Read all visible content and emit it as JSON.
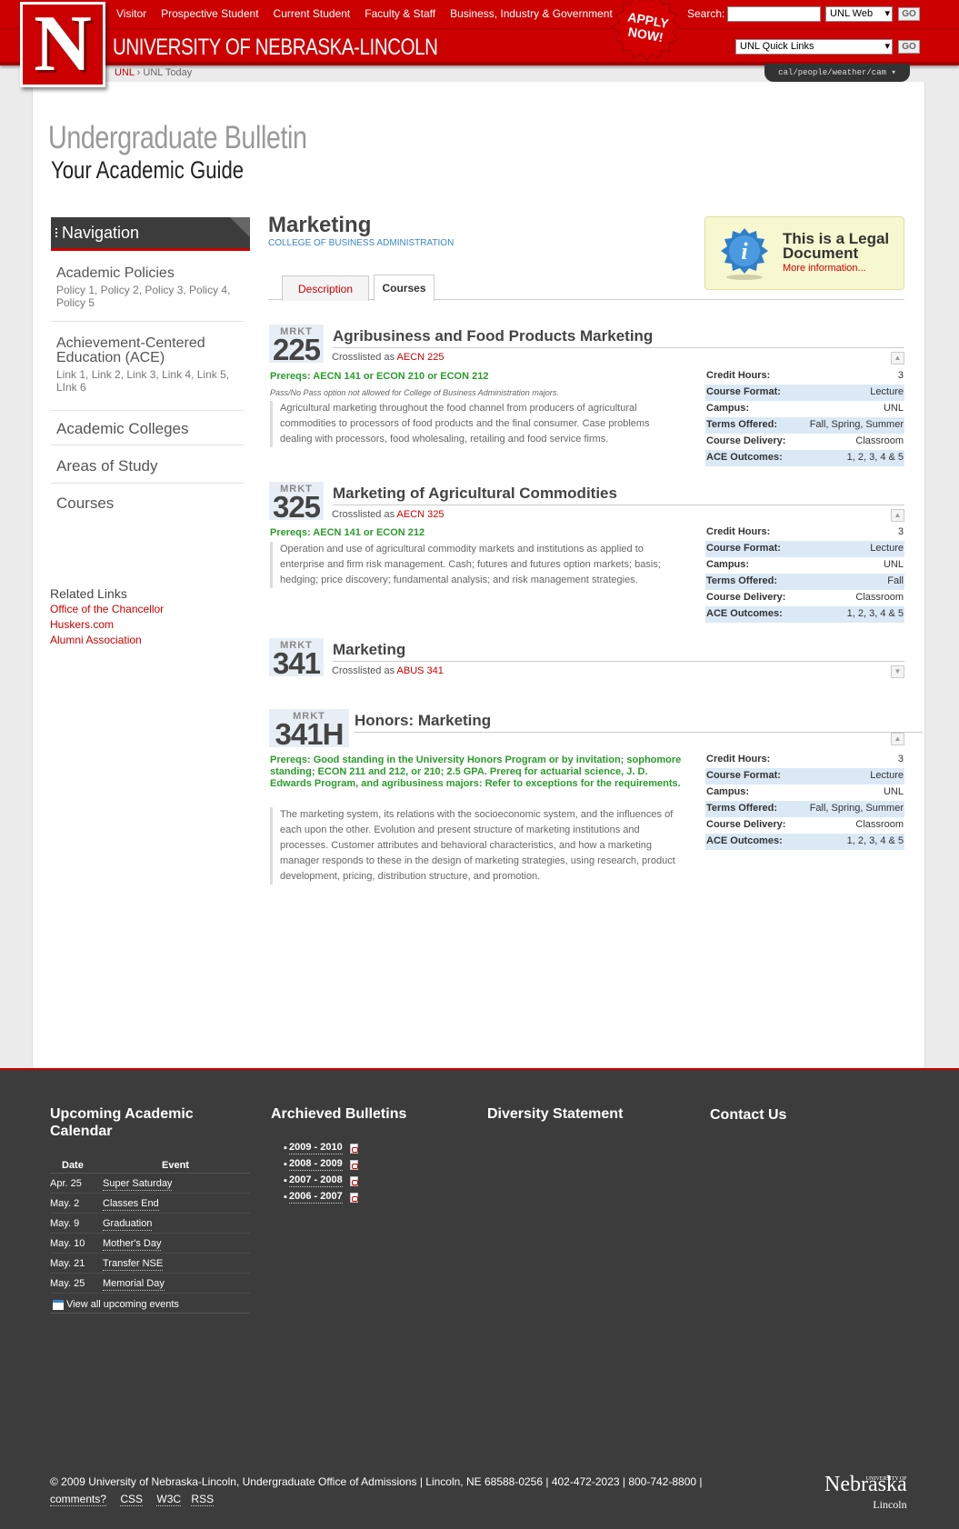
{
  "header": {
    "logo_letter": "N",
    "site_title": "UNIVERSITY OF NEBRASKA-LINCOLN",
    "nav": [
      "Visitor",
      "Prospective Student",
      "Current Student",
      "Faculty & Staff",
      "Business, Industry & Government"
    ],
    "apply_line1": "APPLY",
    "apply_line2": "NOW!",
    "search_label": "Search:",
    "search_scope": "UNL Web",
    "go_label": "GO",
    "quicklinks_label": "UNL Quick Links",
    "breadcrumb": [
      "UNL",
      "UNL Today"
    ],
    "tools": "cal/people/weather/cam"
  },
  "bulletin": {
    "title": "Undergraduate Bulletin",
    "subtitle": "Your Academic Guide"
  },
  "sidebar": {
    "nav_title": "Navigation",
    "items": [
      {
        "label": "Academic Policies",
        "sub": "Policy 1, Policy 2, Policy 3, Policy 4, Policy 5"
      },
      {
        "label": "Achievement-Centered Education (ACE)",
        "sub": "Link 1, Link 2, Link 3, Link 4, Link 5, LInk 6"
      },
      {
        "label": "Academic Colleges",
        "sub": ""
      },
      {
        "label": "Areas of Study",
        "sub": ""
      },
      {
        "label": "Courses",
        "sub": ""
      }
    ],
    "related_title": "Related Links",
    "related": [
      "Office of the Chancellor",
      "Huskers.com",
      "Alumni Association"
    ]
  },
  "main": {
    "title": "Marketing",
    "college": "COLLEGE OF BUSINESS ADMINISTRATION",
    "tabs": [
      "Description",
      "Courses"
    ],
    "legal_title": "This is a Legal Document",
    "legal_link": "More information...",
    "fact_labels": [
      "Credit Hours:",
      "Course Format:",
      "Campus:",
      "Terms Offered:",
      "Course Delivery:",
      "ACE Outcomes:"
    ],
    "crosslisted_prefix": "Crosslisted as",
    "courses": [
      {
        "subject": "MRKT",
        "number": "225",
        "title": "Agribusiness and Food Products Marketing",
        "crosslist": "AECN 225",
        "prereq": "Prereqs: AECN 141 or ECON 210 or ECON 212",
        "note": "Pass/No Pass option not allowed for College of Business Administration majors.",
        "description": "Agricultural marketing throughout the food channel from producers of agricultural commodities to processors of food products and the final consumer. Case problems dealing with processors, food wholesaling, retailing and food service firms.",
        "facts": [
          "3",
          "Lecture",
          "UNL",
          "Fall, Spring, Summer",
          "Classroom",
          "1, 2, 3, 4 & 5"
        ]
      },
      {
        "subject": "MRKT",
        "number": "325",
        "title": "Marketing of Agricultural Commodities",
        "crosslist": "AECN 325",
        "prereq": "Prereqs: AECN 141 or ECON 212",
        "description": "Operation and use of agricultural commodity markets and institutions as applied to enterprise and firm risk management. Cash; futures and futures option markets; basis; hedging; price discovery; fundamental analysis; and risk management strategies.",
        "facts": [
          "3",
          "Lecture",
          "UNL",
          "Fall",
          "Classroom",
          "1, 2, 3, 4 & 5"
        ]
      },
      {
        "subject": "MRKT",
        "number": "341",
        "title": "Marketing",
        "crosslist": "ABUS 341"
      },
      {
        "subject": "MRKT",
        "number": "341H",
        "title": "Honors: Marketing",
        "prereq": "Prereqs: Good standing in the University Honors Program or by invitation; sophomore standing; ECON 211 and 212, or 210; 2.5 GPA.  Prereq for actuarial science, J. D. Edwards Program, and agribusiness majors: Refer to exceptions for the requirements.",
        "description": "The marketing system, its relations with the socioeconomic system, and the influences of each upon the other. Evolution and present structure of marketing institutions and processes. Customer attributes and behavioral characteristics, and how a marketing manager responds to these in the design of marketing strategies, using research, product development, pricing, distribution structure, and promotion.",
        "facts": [
          "3",
          "Lecture",
          "UNL",
          "Fall, Spring, Summer",
          "Classroom",
          "1, 2, 3, 4 & 5"
        ]
      }
    ]
  },
  "footer": {
    "calendar_title": "Upcoming Academic Calendar",
    "calendar_headers": [
      "Date",
      "Event"
    ],
    "events": [
      {
        "date": "Apr. 25",
        "event": "Super Saturday"
      },
      {
        "date": "May. 2",
        "event": "Classes End"
      },
      {
        "date": "May. 9",
        "event": "Graduation"
      },
      {
        "date": "May. 10",
        "event": "Mother's Day"
      },
      {
        "date": "May. 21",
        "event": "Transfer NSE"
      },
      {
        "date": "May. 25",
        "event": "Memorial Day"
      }
    ],
    "view_all": "View all upcoming events",
    "archived_title": "Archieved Bulletins",
    "archived": [
      "2009 - 2010",
      "2008 - 2009",
      "2007 - 2008",
      "2006 - 2007"
    ],
    "diversity_title": "Diversity Statement",
    "contact_title": "Contact Us",
    "copyright": "© 2009 University of Nebraska-Lincoln, Undergraduate Office of Admissions | Lincoln, NE 68588-0256 | 402-472-2023 | 800-742-8800 |",
    "links": [
      "comments?",
      "CSS",
      "W3C",
      "RSS"
    ],
    "logo_top": "UNIVERSITY OF",
    "logo_main": "Nebraska",
    "logo_sub": "Lincoln"
  },
  "colors": {
    "brand": "#cc0000",
    "link_blue": "#3a87c8",
    "prereq_green": "#2a9c2a",
    "footer_bg": "#3c3c3c"
  }
}
